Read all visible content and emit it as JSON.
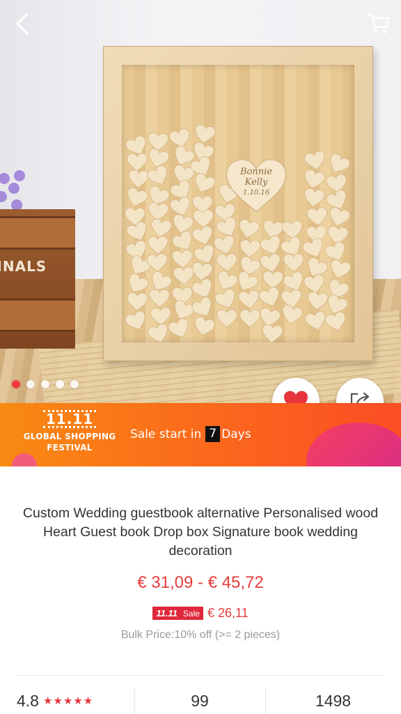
{
  "navigation": {
    "back_icon": "chevron-left-icon",
    "cart_icon": "shopping-cart-icon"
  },
  "gallery": {
    "total_images": 5,
    "active_index": 0,
    "engraving": [
      "Bonnie",
      "Kelly",
      "1.10.16"
    ],
    "crate_label": "SINALS"
  },
  "actions": {
    "wishlist_icon": "heart-icon",
    "share_icon": "share-icon"
  },
  "banner": {
    "logo_number": "11.11",
    "logo_line1": "GLOBAL SHOPPING",
    "logo_line2": "FESTIVAL",
    "sale_prefix": "Sale start in",
    "sale_days": "7",
    "sale_suffix": "Days",
    "colors": {
      "start": "#f88a12",
      "end": "#fb4d25"
    }
  },
  "product": {
    "title": "Custom Wedding guestbook alternative Personalised wood Heart Guest book Drop box Signature book wedding decoration",
    "price_range": "€ 31,09 - € 45,72",
    "promo_badge_event": "11.11",
    "promo_badge_label": "Sale",
    "promo_price": "€ 26,11",
    "bulk_price": "Bulk Price:10% off (>= 2 pieces)"
  },
  "stats": {
    "rating": "4.8",
    "stars": "★★★★★",
    "orders": "99",
    "wishes": "1498"
  },
  "theme": {
    "accent": "#e63b3b",
    "heart_red": "#e8343c"
  }
}
